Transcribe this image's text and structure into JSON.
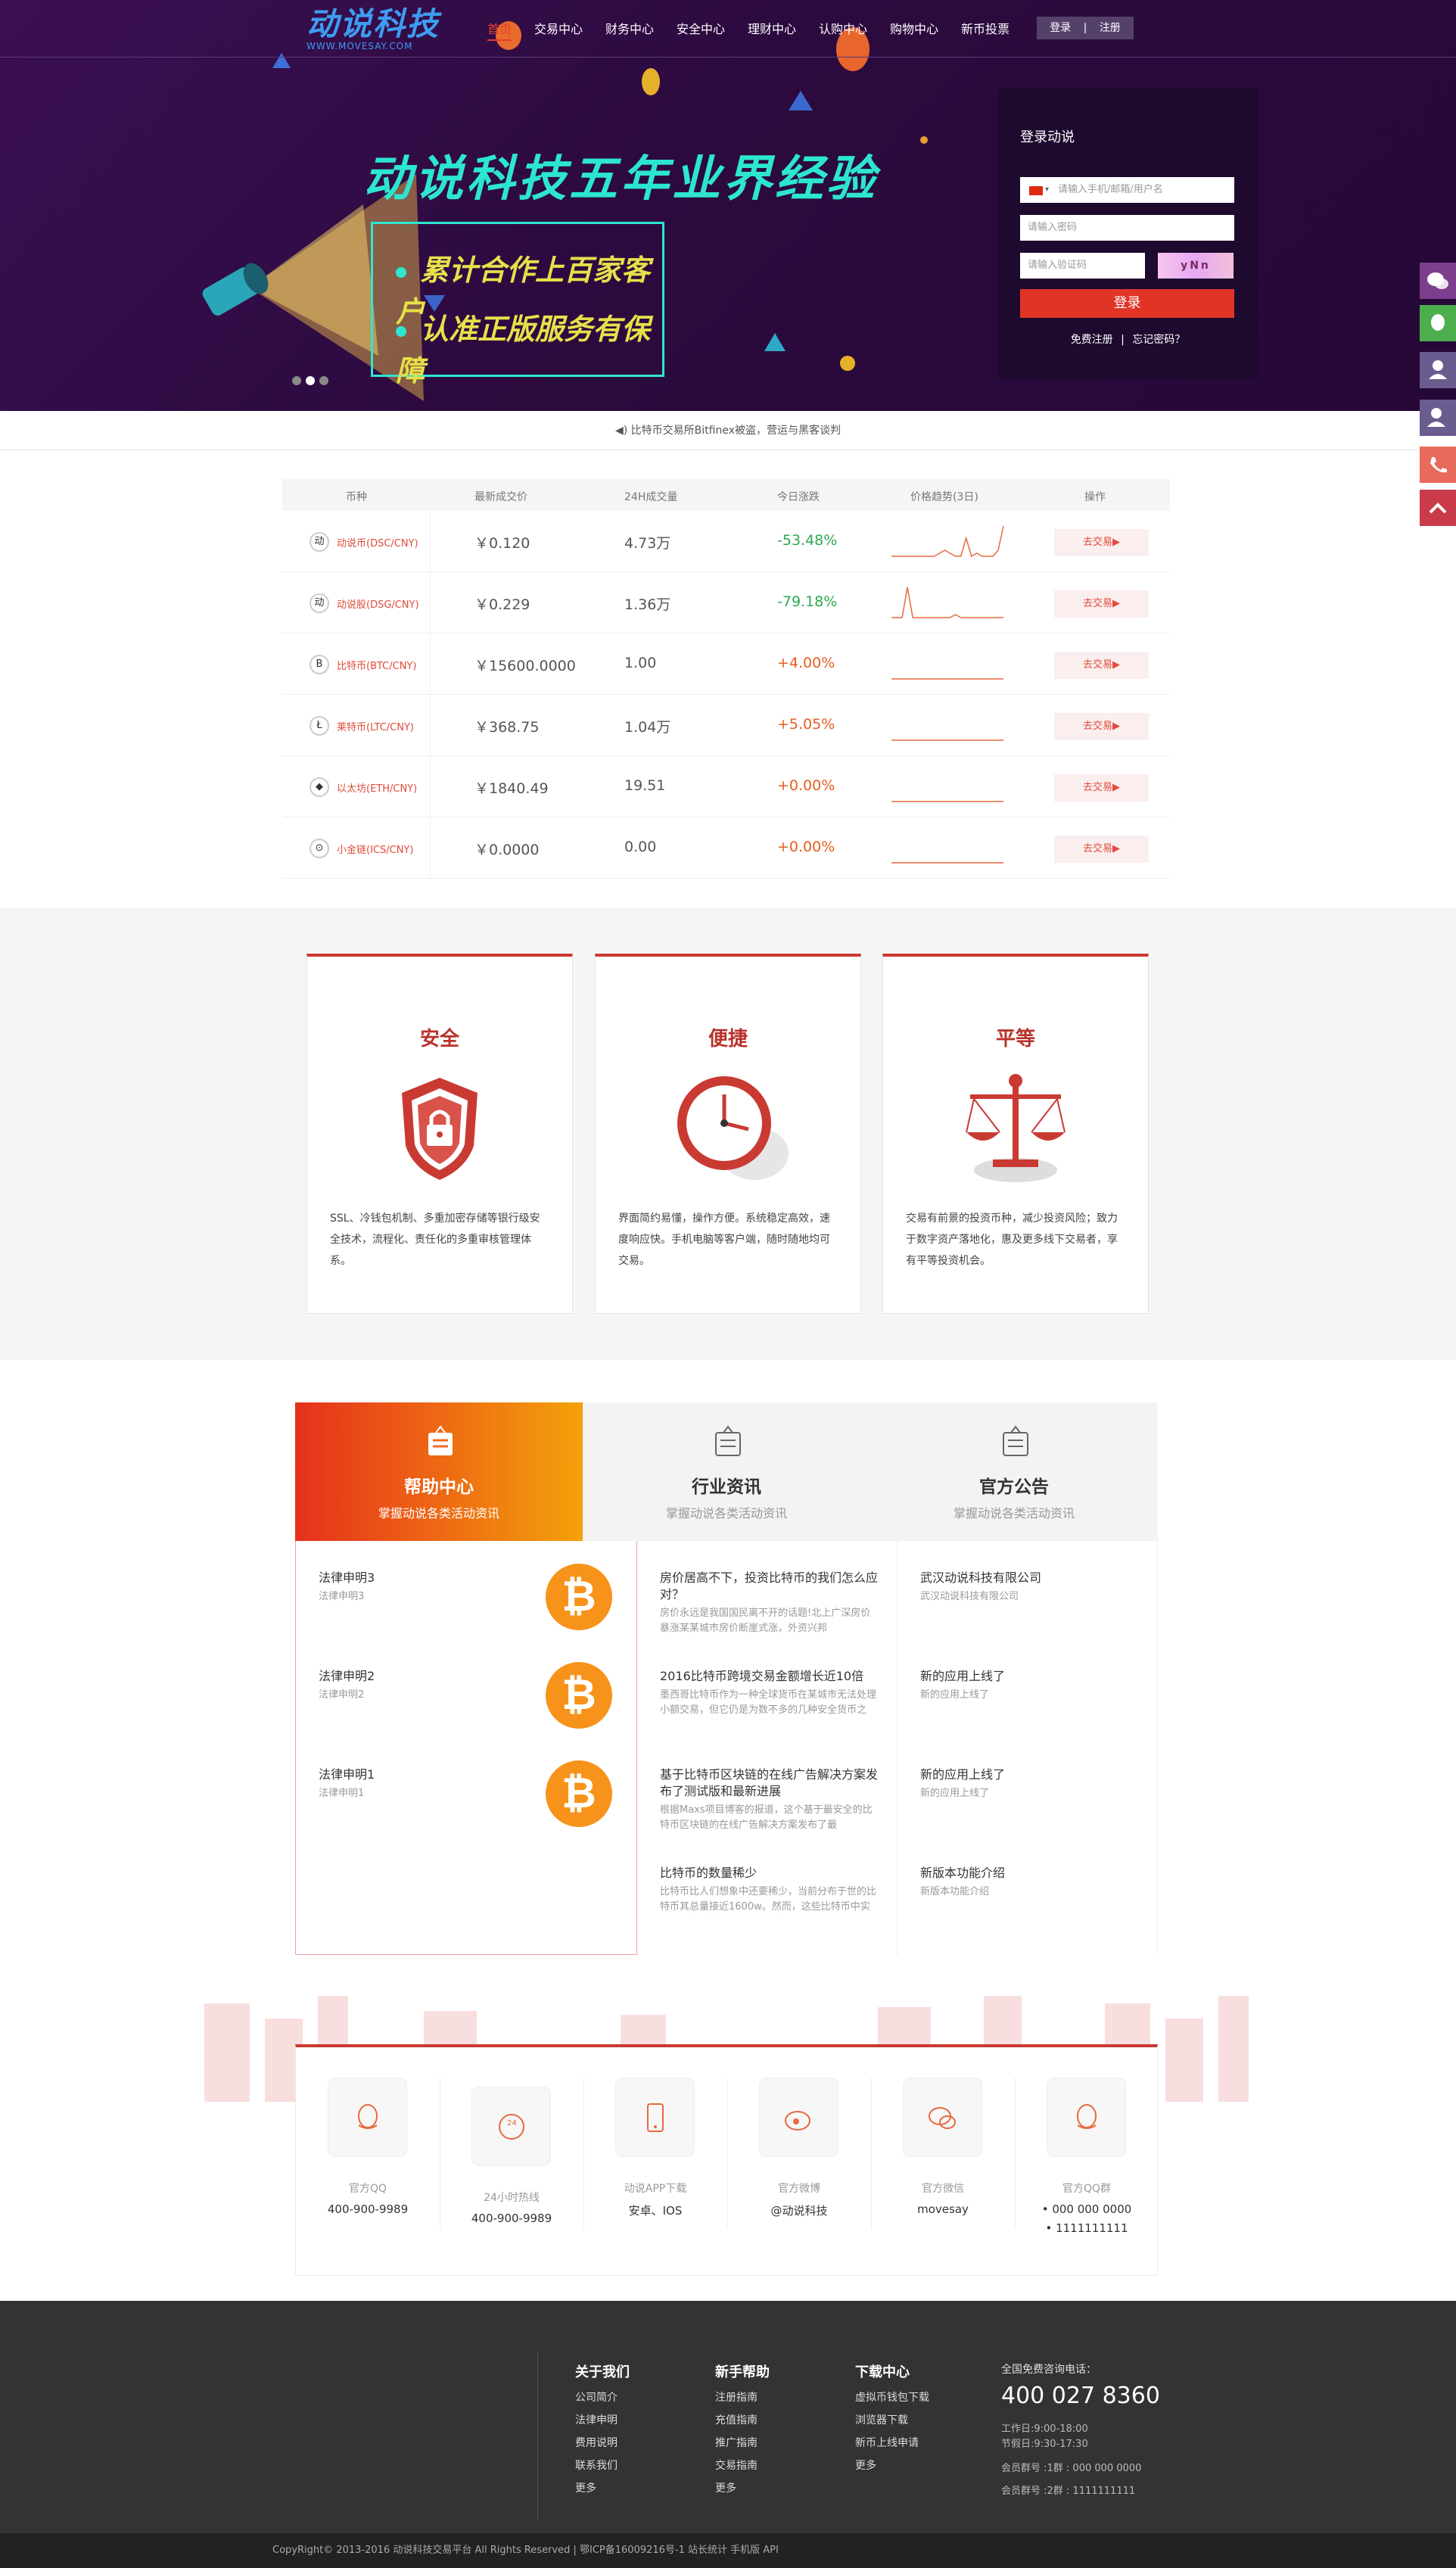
{
  "header": {
    "logo_text": "动说科技",
    "logo_sub": "WWW.MOVESAY.COM",
    "nav": [
      "首页",
      "交易中心",
      "财务中心",
      "安全中心",
      "理财中心",
      "认购中心",
      "购物中心",
      "新币投票"
    ],
    "login_label": "登录",
    "register_label": "注册",
    "divider": "|"
  },
  "banner": {
    "headline": "动说科技五年业界经验",
    "bullets": [
      "累计合作上百家客户",
      "认准正版服务有保障"
    ]
  },
  "login": {
    "title": "登录动说",
    "user_placeholder": "请输入手机/邮箱/用户名",
    "password_placeholder": "请输入密码",
    "captcha_placeholder": "请输入验证码",
    "captcha_text": "yNn",
    "submit": "登录",
    "register_link": "免费注册",
    "link_sep": "|",
    "forgot_link": "忘记密码？"
  },
  "notice": {
    "icon": "speaker-icon",
    "text": "比特币交易所Bitfinex被盗，营运与黑客谈判"
  },
  "market": {
    "headers": [
      "币种",
      "最新成交价",
      "24H成交量",
      "今日涨跌",
      "价格趋势(3日)",
      "操作"
    ],
    "rows": [
      {
        "name": "动说币(DSC/CNY)",
        "icon": "动",
        "price": "￥0.120",
        "volume": "4.73万",
        "change": "-53.48%",
        "trend": [
          0,
          0,
          0,
          0,
          0,
          0,
          0,
          0,
          0,
          1,
          2,
          1,
          0,
          0,
          6,
          0,
          1,
          0,
          0,
          0,
          2,
          10
        ],
        "action": "去交易▶",
        "up": false
      },
      {
        "name": "动说股(DSG/CNY)",
        "icon": "动",
        "price": "￥0.229",
        "volume": "1.36万",
        "change": "-79.18%",
        "trend": [
          0,
          0,
          0,
          10,
          0,
          0,
          0,
          0,
          0,
          0,
          0,
          0,
          1,
          0,
          0,
          0,
          0,
          0,
          0,
          0,
          0,
          0
        ],
        "action": "去交易▶",
        "up": false
      },
      {
        "name": "比特币(BTC/CNY)",
        "icon": "B",
        "price": "￥15600.0000",
        "volume": "1.00",
        "change": "+4.00%",
        "trend": [
          0,
          0,
          0,
          0,
          0,
          0,
          0,
          0,
          0,
          0,
          0,
          0,
          0,
          0,
          0,
          0,
          0,
          0,
          0,
          0,
          0,
          0
        ],
        "action": "去交易▶",
        "up": true
      },
      {
        "name": "莱特币(LTC/CNY)",
        "icon": "Ł",
        "price": "￥368.75",
        "volume": "1.04万",
        "change": "+5.05%",
        "trend": [
          0,
          0,
          0,
          0,
          0,
          0,
          0,
          0,
          0,
          0,
          0,
          0,
          0,
          0,
          0,
          0,
          0,
          0,
          0,
          0,
          0,
          0
        ],
        "action": "去交易▶",
        "up": true
      },
      {
        "name": "以太坊(ETH/CNY)",
        "icon": "◆",
        "price": "￥1840.49",
        "volume": "19.51",
        "change": "+0.00%",
        "trend": [
          0,
          0,
          0,
          0,
          0,
          0,
          0,
          0,
          0,
          0,
          0,
          0,
          0,
          0,
          0,
          0,
          0,
          0,
          0,
          0,
          0,
          0
        ],
        "action": "去交易▶",
        "up": true
      },
      {
        "name": "小金链(ICS/CNY)",
        "icon": "⊙",
        "price": "￥0.0000",
        "volume": "0.00",
        "change": "+0.00%",
        "trend": [
          0,
          0,
          0,
          0,
          0,
          0,
          0,
          0,
          0,
          0,
          0,
          0,
          0,
          0,
          0,
          0,
          0,
          0,
          0,
          0,
          0,
          0
        ],
        "action": "去交易▶",
        "up": true
      }
    ]
  },
  "features": [
    {
      "title": "安全",
      "icon": "shield-lock-icon",
      "desc": "SSL、冷钱包机制、多重加密存储等银行级安全技术，流程化、责任化的多重审核管理体系。"
    },
    {
      "title": "便捷",
      "icon": "clock-icon",
      "desc": "界面简约易懂，操作方便。系统稳定高效，速度响应快。手机电脑等客户端，随时随地均可交易。"
    },
    {
      "title": "平等",
      "icon": "scale-icon",
      "desc": "交易有前景的投资币种，减少投资风险；致力于数字资产落地化，惠及更多线下交易者，享有平等投资机会。"
    }
  ],
  "news": {
    "tabs": [
      {
        "title": "帮助中心",
        "sub": "掌握动说各类活动资讯"
      },
      {
        "title": "行业资讯",
        "sub": "掌握动说各类活动资讯"
      },
      {
        "title": "官方公告",
        "sub": "掌握动说各类活动资讯"
      }
    ],
    "help": [
      {
        "title": "法律申明3",
        "sub": "法律申明3"
      },
      {
        "title": "法律申明2",
        "sub": "法律申明2"
      },
      {
        "title": "法律申明1",
        "sub": "法律申明1"
      }
    ],
    "industry": [
      {
        "title": "房价居高不下，投资比特币的我们怎么应对？",
        "desc": "房价永远是我国国民离不开的话题!北上广深房价暴涨某某城市房价断崖式涨，外资兴邦"
      },
      {
        "title": "2016比特币跨境交易金额增长近10倍",
        "desc": "墨西哥比特币作为一种全球货币在某城市无法处理小额交易，但它仍是为数不多的几种安全货币之一，它能够帮助用户在数据资产中"
      },
      {
        "title": "基于比特币区块链的在线广告解决方案发布了测试版和最新进展",
        "desc": "根据Maxs项目博客的报道，这个基于最安全的比特币区块链的在线广告解决方案发布了最"
      },
      {
        "title": "比特币的数量稀少",
        "desc": "比特币比人们想象中还要稀少，当前分布于世的比特币其总量接近1600w。然而，这些比特币中实际上只有少数流通而已，很多人"
      }
    ],
    "announce": [
      {
        "title": "武汉动说科技有限公司",
        "sub": "武汉动说科技有限公司"
      },
      {
        "title": "新的应用上线了",
        "sub": "新的应用上线了"
      },
      {
        "title": "新的应用上线了",
        "sub": "新的应用上线了"
      },
      {
        "title": "新版本功能介绍",
        "sub": "新版本功能介绍"
      }
    ]
  },
  "contact": [
    {
      "label": "官方QQ",
      "value": "400-900-9989",
      "icon": "qq-icon"
    },
    {
      "label": "24小时热线",
      "value": "400-900-9989",
      "icon": "phone-24-icon"
    },
    {
      "label": "动说APP下载",
      "value": "安卓、IOS",
      "icon": "mobile-icon"
    },
    {
      "label": "官方微博",
      "value": "@动说科技",
      "icon": "weibo-icon"
    },
    {
      "label": "官方微信",
      "value": "movesay",
      "icon": "wechat-icon"
    },
    {
      "label": "官方QQ群",
      "value": "• 000 000 0000",
      "value2": "• 1111111111",
      "icon": "qq-group-icon"
    }
  ],
  "footer": {
    "cols": [
      {
        "title": "关于我们",
        "links": [
          "公司简介",
          "法律申明",
          "费用说明",
          "联系我们",
          "更多"
        ]
      },
      {
        "title": "新手帮助",
        "links": [
          "注册指南",
          "充值指南",
          "推广指南",
          "交易指南",
          "更多"
        ]
      },
      {
        "title": "下载中心",
        "links": [
          "虚拟币钱包下载",
          "浏览器下载",
          "新币上线申请",
          "更多"
        ]
      }
    ],
    "hotline_label": "全国免费咨询电话：",
    "hotline": "400 027 8360",
    "hours1": "工作日:9:00-18:00",
    "hours2": "节假日:9:30-17:30",
    "group1": "会员群号 :1群 : 000 000 0000",
    "group2": "会员群号 :2群 : 1111111111",
    "copyright": "CopyRight© 2013-2016 动说科技交易平台 All Rights Reserved  |  鄂ICP备16009216号-1  站长统计 手机版 API"
  },
  "colors": {
    "brand_red": "#c93a33",
    "down": "#2daa50",
    "up": "#e85d1f",
    "banner_bg": "#2c0a3f",
    "accent_teal": "#2de6d0"
  }
}
